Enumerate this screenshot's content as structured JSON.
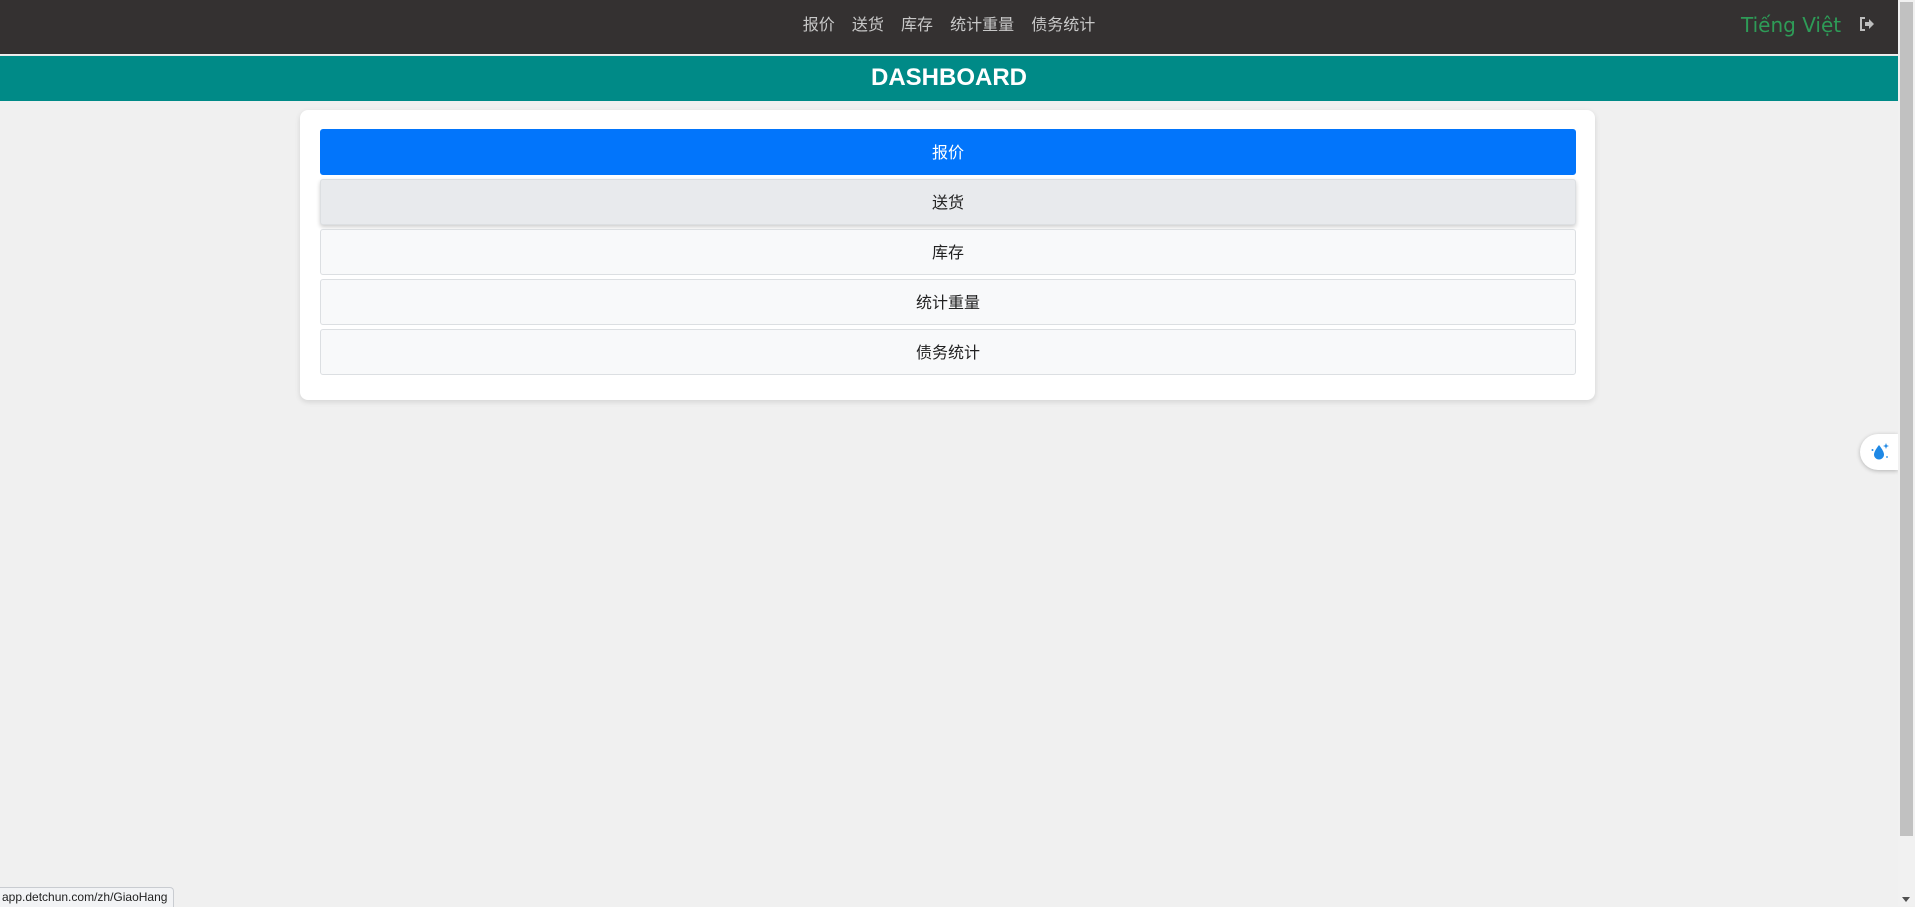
{
  "nav": {
    "links": [
      "报价",
      "送货",
      "库存",
      "统计重量",
      "债务统计"
    ],
    "language": "Tiếng Việt",
    "logout_icon": "sign-out-icon"
  },
  "banner": {
    "title": "DASHBOARD"
  },
  "menu": {
    "items": [
      {
        "label": "报价",
        "state": "active"
      },
      {
        "label": "送货",
        "state": "hover"
      },
      {
        "label": "库存",
        "state": "normal"
      },
      {
        "label": "统计重量",
        "state": "normal"
      },
      {
        "label": "债务统计",
        "state": "normal"
      }
    ]
  },
  "floating_button": {
    "icon": "sparkle-droplet-icon"
  },
  "status_bar": {
    "url": "app.detchun.com/zh/GiaoHang"
  },
  "colors": {
    "nav_bg": "#343131",
    "banner_bg": "#008a87",
    "active_item": "#0275fb",
    "language_link": "#2e9b57"
  }
}
